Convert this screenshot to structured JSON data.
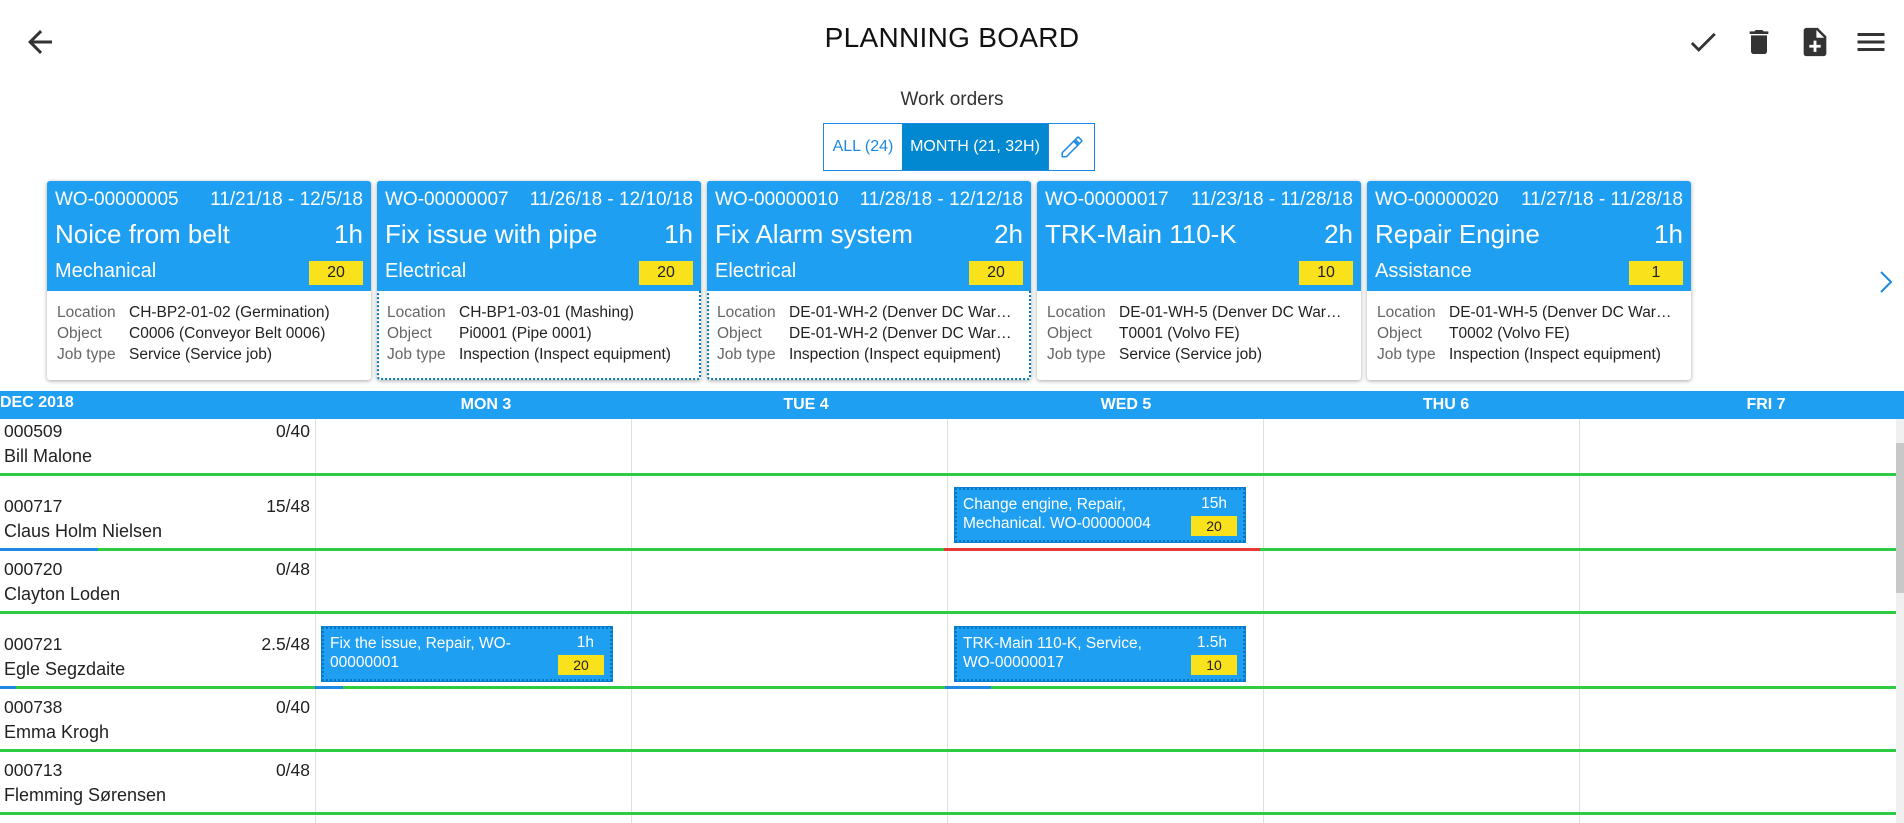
{
  "header": {
    "title": "PLANNING BOARD",
    "icons": [
      "back-arrow-icon",
      "check-icon",
      "trash-icon",
      "add-document-icon",
      "menu-icon"
    ]
  },
  "work_orders": {
    "label": "Work orders",
    "filter_all": "ALL (24)",
    "filter_month": "MONTH (21, 32H)",
    "edit_icon": "pencil-icon"
  },
  "cards": [
    {
      "id": "WO-00000005",
      "dates": "11/21/18 - 12/5/18",
      "title": "Noice from belt",
      "hours": "1h",
      "category": "Mechanical",
      "badge": "20",
      "location": "CH-BP2-01-02 (Germination)",
      "object": "C0006 (Conveyor Belt 0006)",
      "job_type": "Service (Service job)"
    },
    {
      "id": "WO-00000007",
      "dates": "11/26/18 - 12/10/18",
      "title": "Fix issue with pipe",
      "hours": "1h",
      "category": "Electrical",
      "badge": "20",
      "location": "CH-BP1-03-01 (Mashing)",
      "object": "Pi0001 (Pipe 0001)",
      "job_type": "Inspection (Inspect equipment)"
    },
    {
      "id": "WO-00000010",
      "dates": "11/28/18 - 12/12/18",
      "title": "Fix Alarm system",
      "hours": "2h",
      "category": "Electrical",
      "badge": "20",
      "location": "DE-01-WH-2 (Denver DC War…",
      "object": "DE-01-WH-2 (Denver DC War…",
      "job_type": "Inspection (Inspect equipment)"
    },
    {
      "id": "WO-00000017",
      "dates": "11/23/18 - 11/28/18",
      "title": "TRK-Main 110-K",
      "hours": "2h",
      "category": "",
      "badge": "10",
      "location": "DE-01-WH-5 (Denver DC War…",
      "object": "T0001 (Volvo FE)",
      "job_type": "Service (Service job)"
    },
    {
      "id": "WO-00000020",
      "dates": "11/27/18 - 11/28/18",
      "title": "Repair Engine",
      "hours": "1h",
      "category": "Assistance",
      "badge": "1",
      "location": "DE-01-WH-5 (Denver DC War…",
      "object": "T0002 (Volvo FE)",
      "job_type": "Inspection (Inspect equipment)"
    }
  ],
  "card_labels": {
    "location": "Location",
    "object": "Object",
    "job_type": "Job type"
  },
  "schedule": {
    "month": "DEC 2018",
    "days": [
      "MON 3",
      "TUE 4",
      "WED 5",
      "THU 6",
      "FRI 7"
    ],
    "technicians": [
      {
        "id": "000509",
        "name": "Bill Malone",
        "hours": "0/40",
        "progress": 0
      },
      {
        "id": "000717",
        "name": "Claus Holm Nielsen",
        "hours": "15/48",
        "progress": 0.3125
      },
      {
        "id": "000720",
        "name": "Clayton Loden",
        "hours": "0/48",
        "progress": 0
      },
      {
        "id": "000721",
        "name": "Egle Segzdaite",
        "hours": "2.5/48",
        "progress": 0.052
      },
      {
        "id": "000738",
        "name": "Emma Krogh",
        "hours": "0/40",
        "progress": 0
      },
      {
        "id": "000713",
        "name": "Flemming Sørensen",
        "hours": "0/48",
        "progress": 0
      }
    ],
    "jobs": [
      {
        "tech": "000717",
        "day": "WED 5",
        "text": "Change engine, Repair, Mechanical. WO-00000004",
        "hours": "15h",
        "badge": "20"
      },
      {
        "tech": "000721",
        "day": "MON 3",
        "text": "Fix the issue, Repair, WO-00000001",
        "hours": "1h",
        "badge": "20"
      },
      {
        "tech": "000721",
        "day": "WED 5",
        "text": "TRK-Main 110-K, Service, WO-00000017",
        "hours": "1.5h",
        "badge": "10"
      }
    ]
  },
  "colors": {
    "primary": "#1e9ff2",
    "badge": "#f9e11c",
    "capacity_ok": "#2ecc40",
    "capacity_over": "#e53935"
  }
}
